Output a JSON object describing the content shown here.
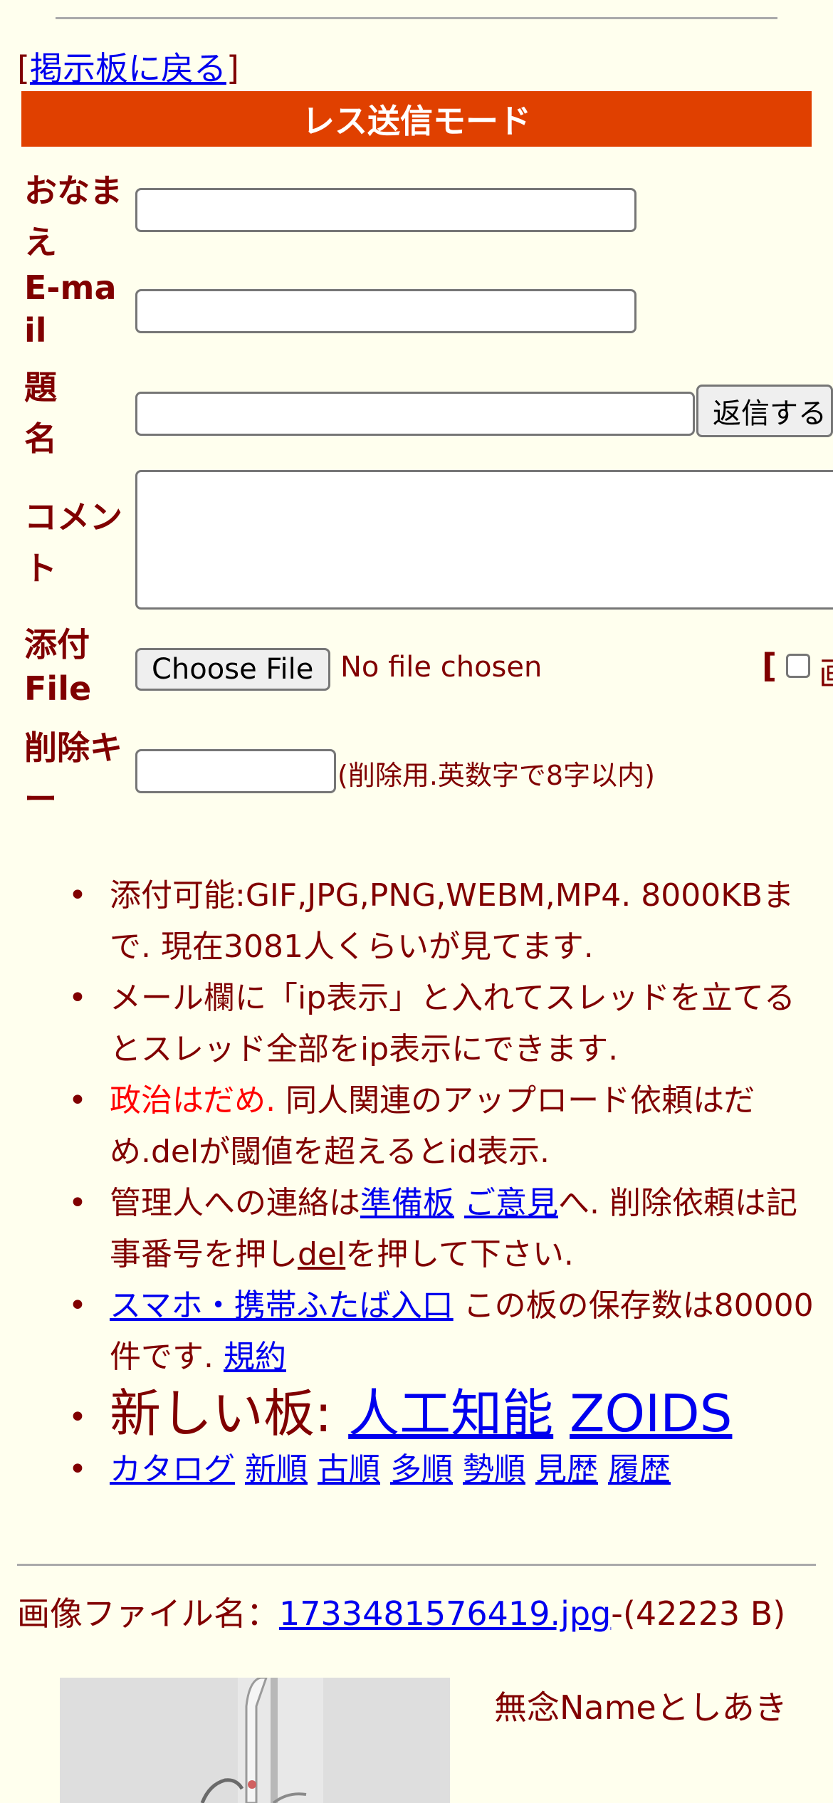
{
  "nav": {
    "back_prefix": "[",
    "back_link": "掲示板に戻る",
    "back_suffix": "]"
  },
  "form": {
    "mode_title": "レス送信モード",
    "name_label": "おなまえ",
    "email_label": "E-mail",
    "subject_label": "題名",
    "submit_label": "返信する",
    "comment_label": "コメント",
    "attach_label": "添付File",
    "choose_file_label": "Choose File",
    "no_file_text": "No file chosen",
    "attach_extra": "[",
    "delete_key_label": "削除キー",
    "delete_key_hint": "(削除用.英数字で8字以内)"
  },
  "notes": {
    "item1": "添付可能:GIF,JPG,PNG,WEBM,MP4. 8000KBまで. 現在3081人くらいが見てます.",
    "item2": "メール欄に「ip表示」と入れてスレッドを立てるとスレッド全部をip表示にできます.",
    "item3_red": "政治はだめ.",
    "item3_rest": " 同人関連のアップロード依頼はだめ.delが閾値を超えるとid表示.",
    "item4_a": "管理人への連絡は",
    "item4_link1": "準備板",
    "item4_link2": "ご意見",
    "item4_b": "へ. 削除依頼は記事番号を押し",
    "item4_link3": "del",
    "item4_c": "を押して下さい.",
    "item5_link": "スマホ・携帯ふたば入口",
    "item5_a": " この板の保存数は80000件です. ",
    "item5_link2": "規約",
    "item6_prefix": "新しい板: ",
    "item6_link1": "人工知能",
    "item6_link2": "ZOIDS",
    "item7_links": [
      "カタログ",
      "新順",
      "古順",
      "多順",
      "勢順",
      "見歴",
      "履歴"
    ]
  },
  "post": {
    "file_prefix": "画像ファイル名：",
    "file_name": "1733481576419.jpg",
    "file_size": "-(42223 B)",
    "poster_text": "無念Nameとしあき"
  }
}
